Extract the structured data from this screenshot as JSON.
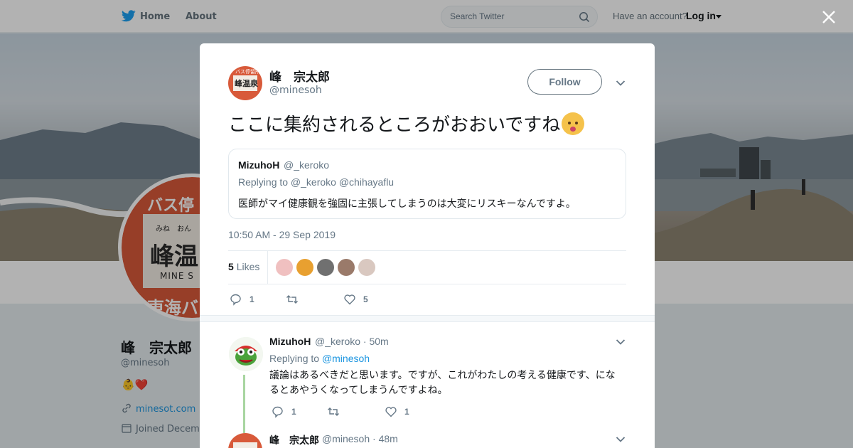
{
  "topbar": {
    "home_label": "Home",
    "about_label": "About",
    "search_placeholder": "Search Twitter",
    "have_account": "Have an account?",
    "login_label": "Log in"
  },
  "profile": {
    "name": "峰　宗太郎",
    "handle": "@minesoh",
    "bio": "👶❤️",
    "website": "minesot.com",
    "joined": "Joined Decem",
    "avatar_text": {
      "top": "バス停",
      "ruby": "みね　おん",
      "main": "峰温",
      "roman": "MINE  S",
      "bottom": "東海バ"
    }
  },
  "modal": {
    "author_name": "峰　宗太郎",
    "author_handle": "@minesoh",
    "avatar_main": "峰温泉",
    "avatar_top": "バス停留所",
    "follow_label": "Follow",
    "tweet_text": "ここに集約されるところがおおいですね",
    "quote": {
      "name": "MizuhoH",
      "handle": "@_keroko",
      "replying": "Replying to @_keroko @chihayaflu",
      "text": "医師がマイ健康観を強固に主張してしまうのは大変にリスキーなんですよ。"
    },
    "timestamp": "10:50 AM - 29 Sep 2019",
    "likes_count": "5",
    "likes_label": "Likes",
    "likers": [
      "#f0c0c0",
      "#e8a030",
      "#707070",
      "#9a7a6a",
      "#d9c8c0"
    ],
    "actions": {
      "reply_count": "1",
      "retweet_count": "",
      "like_count": "5"
    }
  },
  "replies": [
    {
      "name": "MizuhoH",
      "handle": "@_keroko · 50m",
      "replying_prefix": "Replying to ",
      "replying_to": "@minesoh",
      "text": "議論はあるべきだと思います。ですが、これがわたしの考える健康です、になるとあやうくなってしまうんですよね。",
      "reply_count": "1",
      "retweet_count": "",
      "like_count": "1"
    },
    {
      "name": "峰　宗太郎",
      "handle": "@minesoh · 48m"
    }
  ],
  "colors": {
    "accent": "#1da1f2",
    "link_green": "#1b95e0",
    "badge_red": "#d85a3a"
  }
}
